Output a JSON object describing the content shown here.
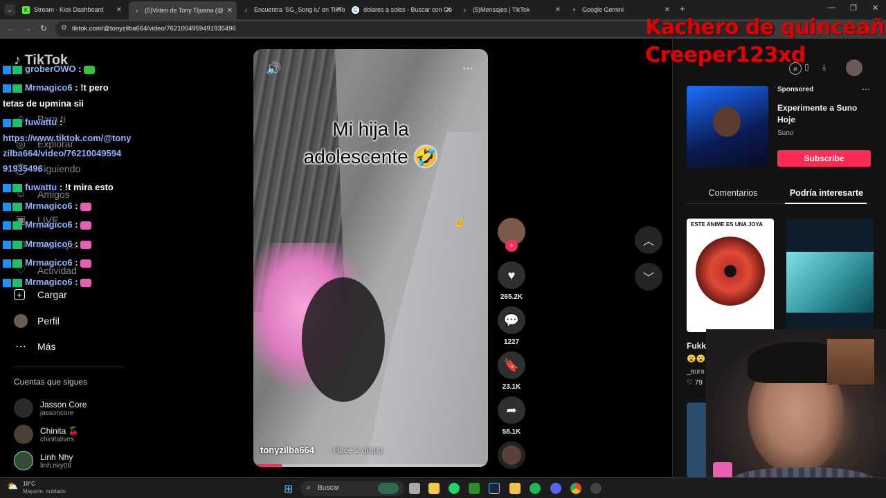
{
  "browser": {
    "tabs": [
      {
        "label": "Stream - Kick Dashboard",
        "icon": "kick-icon",
        "color": "#53fc18"
      },
      {
        "label": "(5)Video de Tony Tijuana (@",
        "icon": "tiktok-icon",
        "color": "#ffffff"
      },
      {
        "label": "Encuentra 'SG_Song iu' en TikTo",
        "icon": "tiktok-icon",
        "color": "#ffffff"
      },
      {
        "label": "dolares a soles - Buscar con Go",
        "icon": "google-icon",
        "color": "#4285f4"
      },
      {
        "label": "(5)Mensajes | TikTok",
        "icon": "tiktok-icon",
        "color": "#ffffff"
      },
      {
        "label": "Google Gemini",
        "icon": "gemini-icon",
        "color": "#4e8cff"
      }
    ],
    "url": "tiktok.com/@tonyzilba664/video/7621004959491935496"
  },
  "overlay": {
    "line1": "Kachero de quinceañ",
    "line2": "Creeper123xd"
  },
  "sidebar": {
    "logo": "TikTok",
    "items": [
      {
        "label": "Para ti",
        "icon": "home-icon"
      },
      {
        "label": "Explorar",
        "icon": "compass-icon"
      },
      {
        "label": "Siguiendo",
        "icon": "following-icon"
      },
      {
        "label": "Amigos",
        "icon": "friends-icon"
      },
      {
        "label": "LIVE",
        "icon": "live-icon"
      },
      {
        "label": "Mensajes",
        "icon": "messages-icon"
      },
      {
        "label": "Actividad",
        "icon": "activity-icon"
      },
      {
        "label": "Cargar",
        "icon": "upload-icon"
      },
      {
        "label": "Perfil",
        "icon": "profile-icon"
      },
      {
        "label": "Más",
        "icon": "more-icon"
      }
    ],
    "following_header": "Cuentas que sigues",
    "following": [
      {
        "name": "Jasson Core",
        "handle": "jassoncore"
      },
      {
        "name": "Chinita 🍒",
        "handle": "chinitalives"
      },
      {
        "name": "Linh Nhy",
        "handle": "linh.nky08"
      }
    ]
  },
  "chat": [
    {
      "user": "groberOWO",
      "msg": ""
    },
    {
      "user": "Mrmagico6",
      "msg": "!t pero"
    },
    {
      "user": "",
      "msg": "tetas de upmina sii"
    },
    {
      "user": "fuwattu",
      "msg": ""
    },
    {
      "user": "",
      "msg": "https://www.tiktok.com/@tony"
    },
    {
      "user": "",
      "msg": "zilba664/video/76210049594"
    },
    {
      "user": "",
      "msg": "91935496"
    },
    {
      "user": "fuwattu",
      "msg": "!t mira esto"
    },
    {
      "user": "Mrmagico6",
      "msg": ""
    },
    {
      "user": "Mrmagico6",
      "msg": ""
    },
    {
      "user": "Mrmagico6",
      "msg": ""
    },
    {
      "user": "Mrmagico6",
      "msg": ""
    },
    {
      "user": "Mrmagico6",
      "msg": ""
    }
  ],
  "video": {
    "caption_line1": "Mi hija la",
    "caption_line2": "adolescente 🤣",
    "author": "tonyzilba664",
    "time": "· Hace 2 día(s)",
    "progress": 0.12
  },
  "actions": {
    "likes": "265.2K",
    "comments": "1227",
    "saves": "23.1K",
    "shares": "58.1K"
  },
  "right_panel": {
    "sponsored": "Sponsored",
    "ad_title": "Experimente a Suno Hoje",
    "ad_brand": "Suno",
    "subscribe": "Subscribe",
    "tabs": [
      "Comentarios",
      "Podría interesarte"
    ],
    "thumb1_text": "ESTE ANIME ES UNA JOYA",
    "thumb1_title": "Fukk",
    "thumb1_user": "_aura",
    "thumb1_likes": "79"
  },
  "taskbar": {
    "weather_temp": "18°C",
    "weather_desc": "Mayorm. nublado",
    "search": "Buscar"
  }
}
